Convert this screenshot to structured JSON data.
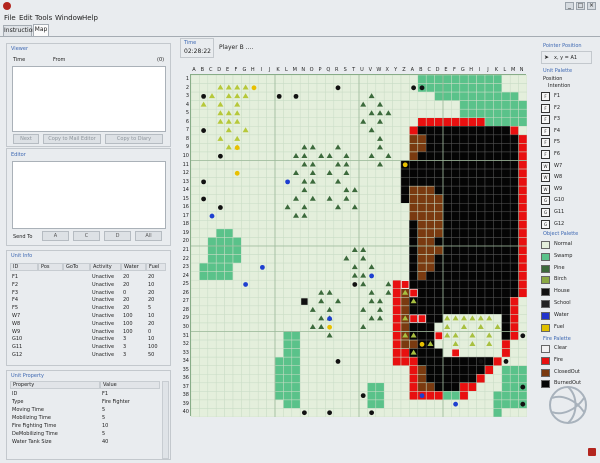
{
  "menu": [
    "File",
    "Edit",
    "Tools",
    "Window",
    "Help"
  ],
  "window_buttons": [
    "_",
    "□",
    "×"
  ],
  "tabs": [
    "Instructions",
    "Map"
  ],
  "viewer": {
    "title": "Viewer",
    "col_time": "Time",
    "col_from": "From",
    "count": "(0)",
    "buttons": [
      "Next",
      "Copy to Mail Editor",
      "Copy to Diary"
    ]
  },
  "editor": {
    "title": "Editor",
    "send_to": "Send To",
    "targets": [
      "A",
      "C",
      "D",
      "All"
    ]
  },
  "unit_info": {
    "title": "Unit Info",
    "headers": [
      "ID",
      "Pos",
      "GoTo",
      "Activity",
      "Water",
      "Fuel"
    ],
    "rows": [
      [
        "F1",
        "",
        "",
        "Unactive",
        "20",
        "20"
      ],
      [
        "F2",
        "",
        "",
        "Unactive",
        "20",
        "10"
      ],
      [
        "F3",
        "",
        "",
        "Unactive",
        "0",
        "20"
      ],
      [
        "F4",
        "",
        "",
        "Unactive",
        "20",
        "20"
      ],
      [
        "F5",
        "",
        "",
        "Unactive",
        "20",
        "5"
      ],
      [
        "W7",
        "",
        "",
        "Unactive",
        "100",
        "10"
      ],
      [
        "W8",
        "",
        "",
        "Unactive",
        "100",
        "20"
      ],
      [
        "W9",
        "",
        "",
        "Unactive",
        "100",
        "0"
      ],
      [
        "G10",
        "",
        "",
        "Unactive",
        "3",
        "10"
      ],
      [
        "G11",
        "",
        "",
        "Unactive",
        "3",
        "100"
      ],
      [
        "G12",
        "",
        "",
        "Unactive",
        "3",
        "50"
      ]
    ]
  },
  "unit_property": {
    "title": "Unit Property",
    "headers": [
      "Property",
      "Value"
    ],
    "rows": [
      [
        "ID",
        "F1"
      ],
      [
        "Type",
        "Fire Fighter"
      ],
      [
        "Moving Time",
        "5"
      ],
      [
        "Mobilizing Time",
        "5"
      ],
      [
        "Fire Fighting Time",
        "10"
      ],
      [
        "DeMobilizing Time",
        "5"
      ],
      [
        "Water Tank Size",
        "40"
      ]
    ]
  },
  "time": {
    "label": "Time",
    "value": "02:28:22"
  },
  "player": "Player B ....",
  "columns": [
    "A",
    "B",
    "C",
    "D",
    "E",
    "F",
    "G",
    "H",
    "I",
    "J",
    "K",
    "L",
    "M",
    "N",
    "O",
    "P",
    "Q",
    "R",
    "S",
    "T",
    "U",
    "V",
    "W",
    "X",
    "Y",
    "Z",
    "A",
    "B",
    "C",
    "D",
    "E",
    "F",
    "G",
    "H",
    "I",
    "J",
    "K",
    "L",
    "M",
    "N"
  ],
  "rows": [
    "1",
    "2",
    "3",
    "4",
    "5",
    "6",
    "7",
    "8",
    "9",
    "10",
    "11",
    "12",
    "13",
    "14",
    "15",
    "16",
    "17",
    "18",
    "19",
    "20",
    "21",
    "22",
    "23",
    "24",
    "25",
    "26",
    "27",
    "28",
    "29",
    "30",
    "31",
    "32",
    "33",
    "34",
    "35",
    "36",
    "37",
    "38",
    "39",
    "40"
  ],
  "pointer": {
    "title": "Pointer Position",
    "value": "x, y = A1"
  },
  "unit_palette": {
    "title": "Unit Palette",
    "sub": [
      "Position",
      "Intention"
    ],
    "items": [
      {
        "code": "F",
        "name": "F1"
      },
      {
        "code": "F",
        "name": "F2"
      },
      {
        "code": "F",
        "name": "F3"
      },
      {
        "code": "F",
        "name": "F4"
      },
      {
        "code": "F",
        "name": "F5"
      },
      {
        "code": "F",
        "name": "F6"
      },
      {
        "code": "W",
        "name": "W7"
      },
      {
        "code": "W",
        "name": "W8"
      },
      {
        "code": "W",
        "name": "W9"
      },
      {
        "code": "G",
        "name": "G10"
      },
      {
        "code": "G",
        "name": "G11"
      },
      {
        "code": "G",
        "name": "G12"
      }
    ]
  },
  "object_palette": {
    "title": "Object Palette",
    "items": [
      {
        "name": "Normal",
        "color": "#e4efdc"
      },
      {
        "name": "Swamp",
        "color": "#5ac28a"
      },
      {
        "name": "Pine",
        "color": "#3c6a3c"
      },
      {
        "name": "Birch",
        "color": "#8aa844"
      },
      {
        "name": "House",
        "color": "#111111"
      },
      {
        "name": "School",
        "color": "#222222"
      },
      {
        "name": "Water",
        "color": "#2233cc"
      },
      {
        "name": "Fuel",
        "color": "#e0c000"
      }
    ]
  },
  "fire_palette": {
    "title": "Fire Palette",
    "items": [
      {
        "name": "Clear",
        "color": "#f2f2f2"
      },
      {
        "name": "Fire",
        "color": "#e81010"
      },
      {
        "name": "ClosedOut",
        "color": "#7a3a10"
      },
      {
        "name": "BurnedOut",
        "color": "#050505"
      }
    ]
  },
  "colors": {
    "grid": "#c9dcc6",
    "normal": "#e4efdc",
    "swamp": "#5ac28a",
    "fire": "#e81010",
    "burned": "#050505",
    "closed": "#7a3a10",
    "pine": "#3c6a3c",
    "birch": "#b6c83a",
    "house": "#111111",
    "water": "#1e3fd0",
    "fuel": "#e8c000",
    "accent": "#3c67b2"
  }
}
